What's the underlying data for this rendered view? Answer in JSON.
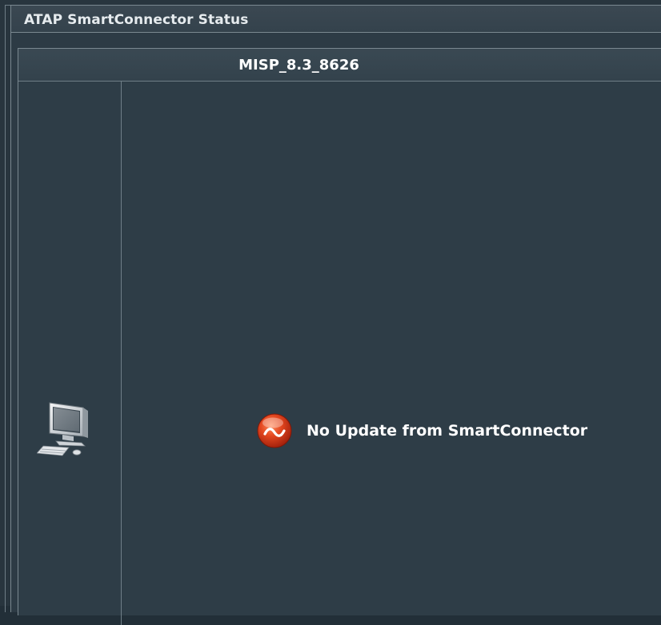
{
  "panel": {
    "title": "ATAP SmartConnector Status"
  },
  "connector": {
    "name": "MISP_8.3_8626",
    "status_text": "No Update from SmartConnector",
    "status_icon": "error-status-icon",
    "device_icon": "computer-icon"
  },
  "colors": {
    "background": "#2d3b45",
    "border": "#7a8890",
    "status_red": "#e2461f",
    "text": "#ffffff"
  }
}
